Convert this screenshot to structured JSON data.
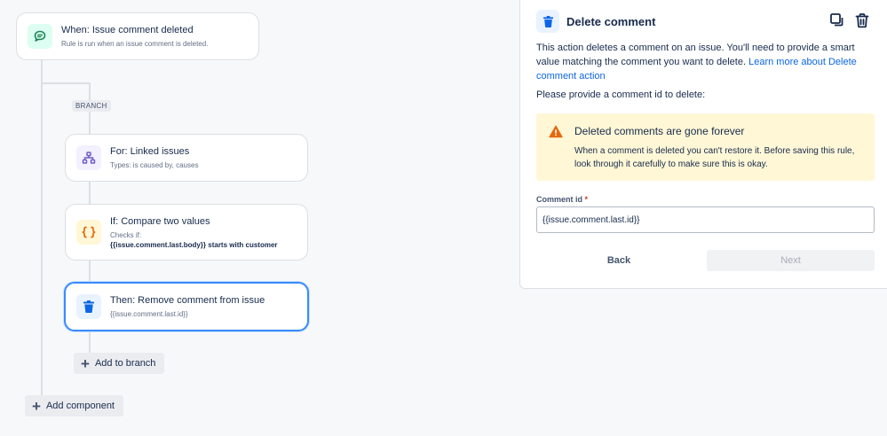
{
  "canvas": {
    "trigger": {
      "title": "When: Issue comment deleted",
      "subtitle": "Rule is run when an issue comment is deleted."
    },
    "branch_label": "BRANCH",
    "branch_card": {
      "title": "For: Linked issues",
      "subtitle": "Types: is caused by, causes"
    },
    "condition_card": {
      "title": "If: Compare two values",
      "subtitle": "Checks if:",
      "detail": "{{issue.comment.last.body}} starts with customer"
    },
    "action_card": {
      "title": "Then: Remove comment from issue",
      "subtitle": "{{issue.comment.last.id}}"
    },
    "add_to_branch": "Add to branch",
    "add_component": "Add component"
  },
  "panel": {
    "title": "Delete comment",
    "description": "This action deletes a comment on an issue. You'll need to provide a smart value matching the comment you want to delete.",
    "learn_more": "Learn more about Delete comment action",
    "prompt": "Please provide a comment id to delete:",
    "warning": {
      "title": "Deleted comments are gone forever",
      "body": "When a comment is deleted you can't restore it. Before saving this rule, look through it carefully to make sure this is okay."
    },
    "field": {
      "label": "Comment id",
      "required_mark": "*",
      "value": "{{issue.comment.last.id}}"
    },
    "back_label": "Back",
    "next_label": "Next"
  },
  "icons": {
    "trigger": "comment-icon",
    "branch": "hierarchy-icon",
    "condition": "curly-braces-icon",
    "action": "trash-icon",
    "duplicate": "duplicate-icon",
    "delete": "trash-icon",
    "warning": "warning-icon",
    "add": "plus-icon"
  },
  "colors": {
    "accent_blue": "#0c66e4",
    "selected_border": "#388bff",
    "warning_bg": "#fff7d6",
    "warning_icon": "#e56910",
    "trigger_green": "#1f845a",
    "branch_purple": "#6e5dc6",
    "condition_orange": "#e56910"
  }
}
